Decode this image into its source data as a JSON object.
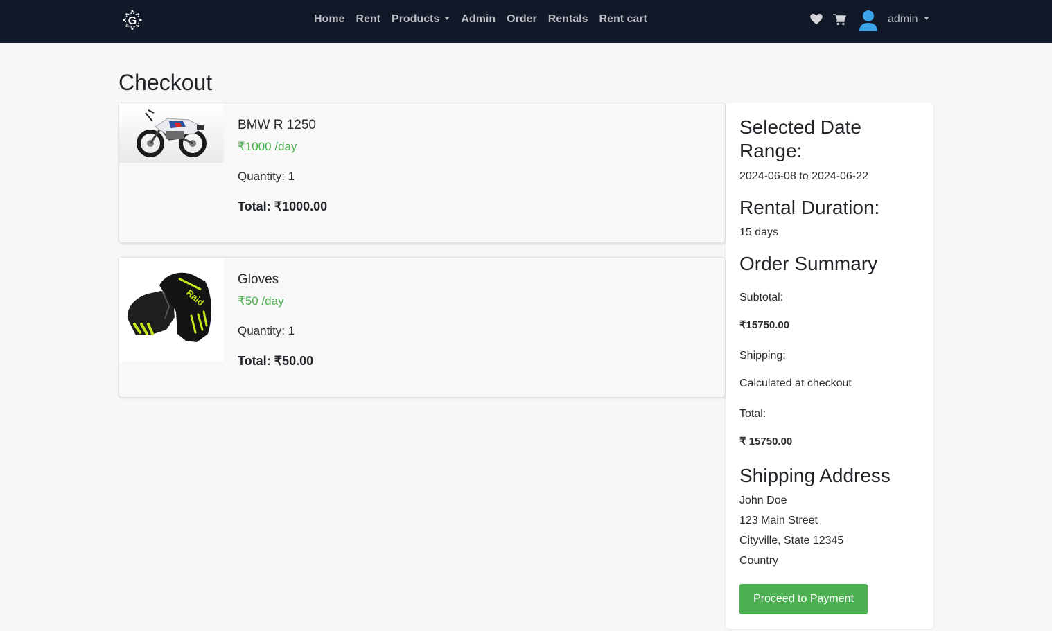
{
  "nav": {
    "links": [
      "Home",
      "Rent",
      "Products",
      "Admin",
      "Order",
      "Rentals",
      "Rent cart"
    ],
    "user_label": "admin",
    "icons": [
      "logo-icon",
      "heart-icon",
      "cart-icon",
      "avatar-icon"
    ]
  },
  "page": {
    "title": "Checkout"
  },
  "items": [
    {
      "name": "BMW R 1250",
      "price": "₹1000 /day",
      "quantity": "Quantity: 1",
      "total": "Total: ₹1000.00"
    },
    {
      "name": "Gloves",
      "price": "₹50 /day",
      "quantity": "Quantity: 1",
      "total": "Total: ₹50.00"
    }
  ],
  "summary": {
    "date_range_heading_1": "Selected Date",
    "date_range_heading_2": "Range:",
    "date_range": "2024-06-08 to 2024-06-22",
    "duration_heading": "Rental Duration:",
    "duration": "15 days",
    "order_heading": "Order Summary",
    "subtotal_label": "Subtotal:",
    "subtotal_value": "₹15750.00",
    "shipping_label": "Shipping:",
    "shipping_value": "Calculated at checkout",
    "total_label": "Total:",
    "total_value": "₹ 15750.00",
    "address_heading": "Shipping Address",
    "address_lines": [
      "John Doe",
      "123 Main Street",
      "Cityville, State 12345",
      "Country"
    ],
    "pay_button": "Proceed to Payment"
  },
  "colors": {
    "navbar": "#111827",
    "accent": "#4caf50",
    "avatar": "#3ba4e8"
  }
}
